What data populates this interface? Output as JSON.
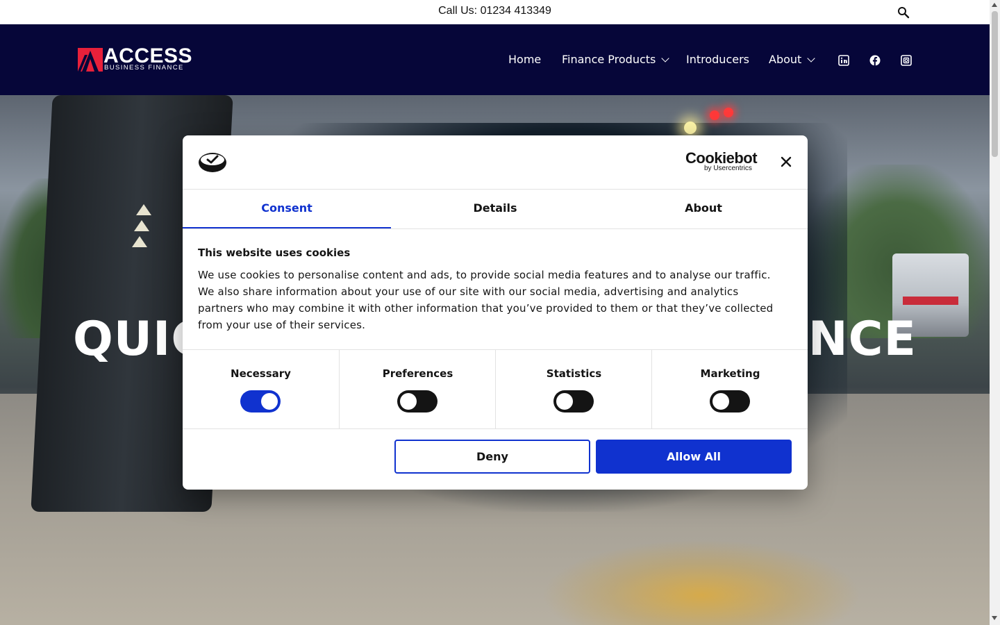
{
  "topbar": {
    "phone": "Call Us: 01234 413349",
    "search_icon": "search-icon"
  },
  "header": {
    "logo": {
      "word": "ACCESS",
      "sub": "BUSINESS FINANCE"
    },
    "nav": [
      {
        "label": "Home",
        "has_dropdown": false
      },
      {
        "label": "Finance Products",
        "has_dropdown": true
      },
      {
        "label": "Introducers",
        "has_dropdown": false
      },
      {
        "label": "About",
        "has_dropdown": true
      }
    ],
    "social_icons": [
      "linkedin-icon",
      "facebook-icon",
      "instagram-icon"
    ]
  },
  "hero": {
    "title_left": "QUICK",
    "title_right": "ANCE"
  },
  "cookie_dialog": {
    "brand": "Cookiebot",
    "brand_sub": "by Usercentrics",
    "tabs": [
      {
        "label": "Consent",
        "active": true
      },
      {
        "label": "Details",
        "active": false
      },
      {
        "label": "About",
        "active": false
      }
    ],
    "heading": "This website uses cookies",
    "body": "We use cookies to personalise content and ads, to provide social media features and to analyse our traffic. We also share information about your use of our site with our social media, advertising and analytics partners who may combine it with other information that you’ve provided to them or that they’ve collected from your use of their services.",
    "categories": [
      {
        "label": "Necessary",
        "enabled": true
      },
      {
        "label": "Preferences",
        "enabled": false
      },
      {
        "label": "Statistics",
        "enabled": false
      },
      {
        "label": "Marketing",
        "enabled": false
      }
    ],
    "deny_label": "Deny",
    "allow_label": "Allow All"
  },
  "colors": {
    "header_bg": "#060639",
    "accent_blue": "#1032cf",
    "logo_red": "#e8203a"
  }
}
